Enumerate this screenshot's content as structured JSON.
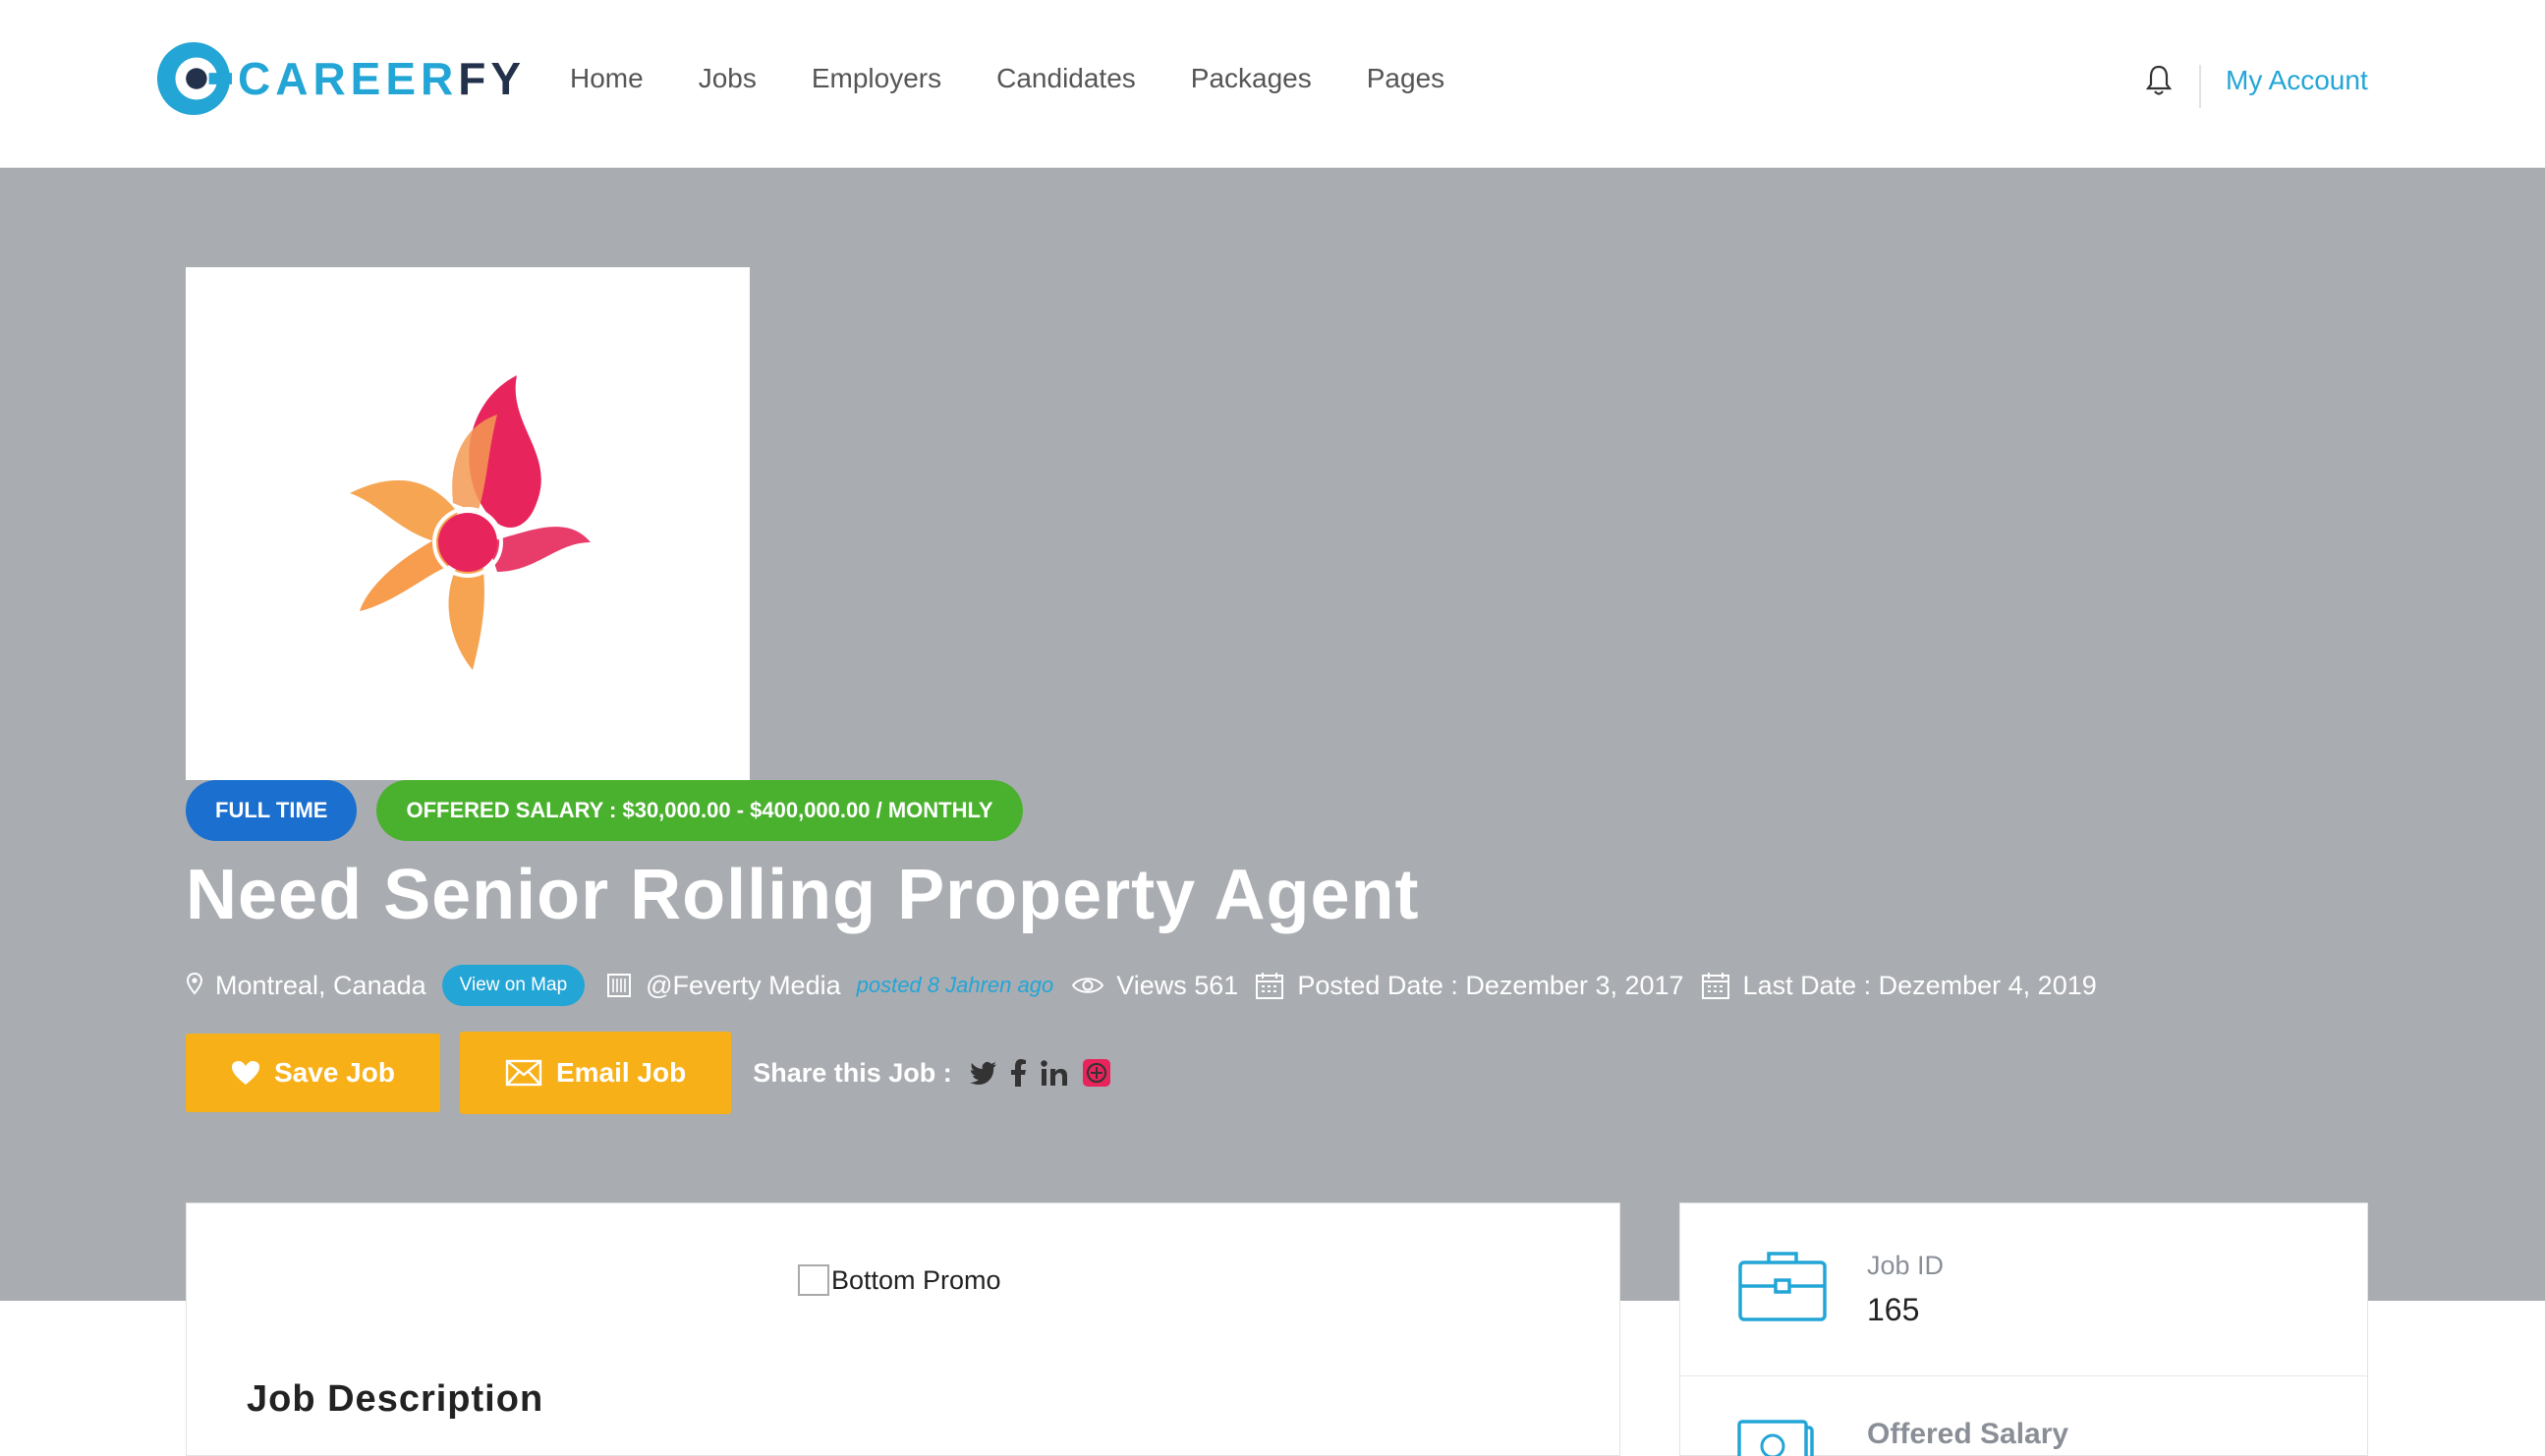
{
  "header": {
    "logo_text_a": "CAREER",
    "logo_text_b": "FY",
    "nav": [
      "Home",
      "Jobs",
      "Employers",
      "Candidates",
      "Packages",
      "Pages"
    ],
    "account_label": "My Account"
  },
  "job": {
    "badge_type": "FULL TIME",
    "badge_salary": "OFFERED SALARY : $30,000.00 - $400,000.00 / MONTHLY",
    "title": "Need Senior Rolling Property Agent",
    "location": "Montreal, Canada",
    "map_label": "View on Map",
    "company": "@Feverty Media",
    "posted": "posted 8 Jahren ago",
    "views": "Views 561",
    "posted_date": "Posted Date : Dezember 3, 2017",
    "last_date": "Last Date : Dezember 4, 2019"
  },
  "actions": {
    "save_label": "Save Job",
    "email_label": "Email Job",
    "share_label": "Share this Job :"
  },
  "main": {
    "promo_alt": "Bottom Promo",
    "section_title": "Job Description"
  },
  "sidebar": {
    "job_id_label": "Job ID",
    "job_id_value": "165",
    "salary_label": "Offered Salary"
  },
  "colors": {
    "accent": "#23a5d6",
    "hero_bg": "#a9acb1",
    "button": "#f8b019",
    "badge_blue": "#1a6fcf",
    "badge_green": "#4ab12f"
  }
}
